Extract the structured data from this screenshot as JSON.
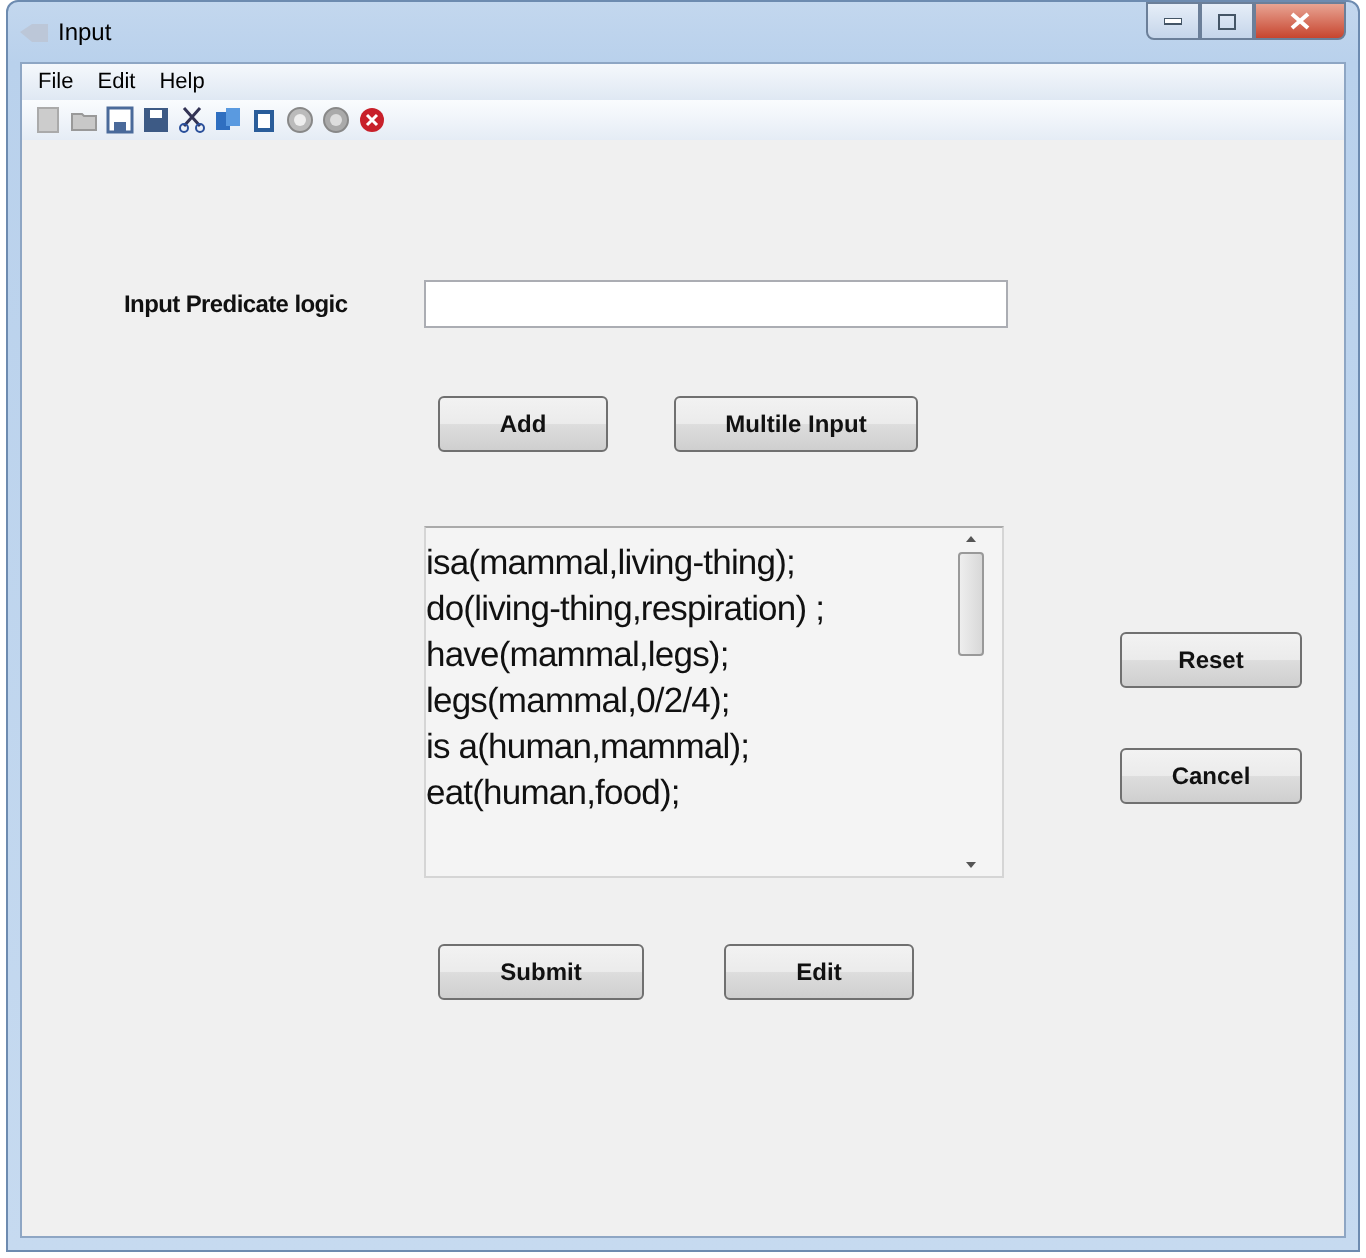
{
  "window": {
    "title": "Input"
  },
  "menu": [
    "File",
    "Edit",
    "Help"
  ],
  "form": {
    "label": "Input Predicate logic"
  },
  "buttons_top": [
    "Add",
    "Multile Input"
  ],
  "text_area": {
    "lines": [
      "isa(mammal,living-thing);",
      "do(living-thing,respiration) ;",
      "have(mammal,legs);",
      "legs(mammal,0/2/4);",
      "is a(human,mammal);",
      "eat(human,food);"
    ]
  },
  "buttons_side": [
    "Reset",
    "Cancel"
  ],
  "buttons_bottom": [
    "Submit",
    "Edit"
  ]
}
